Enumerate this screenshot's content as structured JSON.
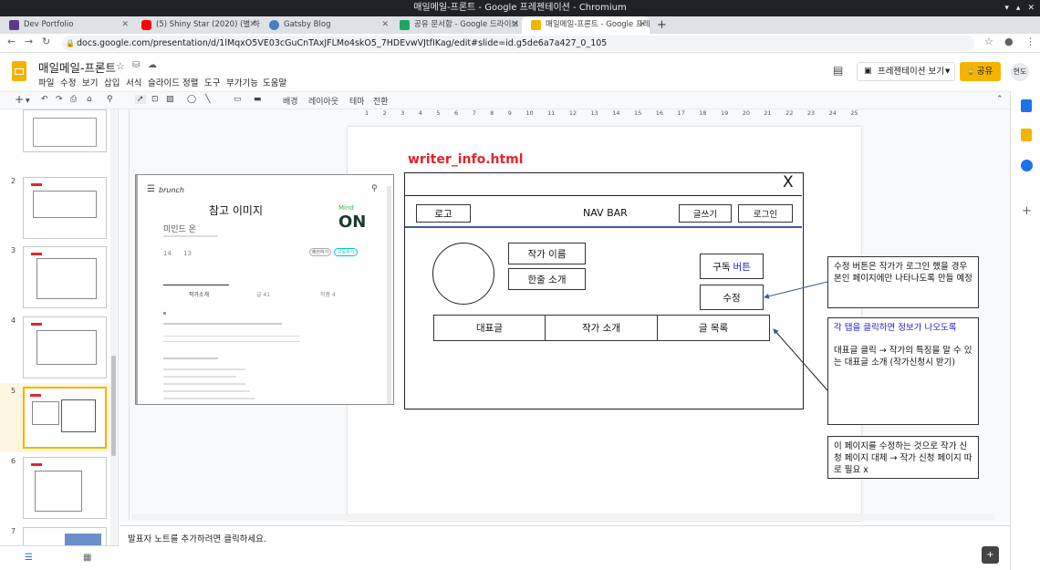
{
  "window": {
    "title": "매일메일-프론트 - Google 프레젠테이션 - Chromium"
  },
  "tabs": [
    {
      "label": "Dev Portfolio",
      "color": "#5b3a8e"
    },
    {
      "label": "(5) Shiny Star (2020) (별 하",
      "color": "#ff0000"
    },
    {
      "label": "Gatsby Blog",
      "color": "#4a7fc1"
    },
    {
      "label": "공유 문서함 - Google 드라이브",
      "color": "#1fa463"
    },
    {
      "label": "매일메일-프론트 - Google 프레젠",
      "color": "#f4b400"
    }
  ],
  "address": {
    "url": "docs.google.com/presentation/d/1lMqxO5VE03cGuCnTAxJFLMo4skO5_7HDEvwVJtfIKag/edit#slide=id.g5de6a7a427_0_105"
  },
  "doc": {
    "title": "매일메일-프론트",
    "menu": [
      "파일",
      "수정",
      "보기",
      "삽입",
      "서식",
      "슬라이드",
      "정렬",
      "도구",
      "부가기능",
      "도움말"
    ],
    "present_label": "프레젠테이션 보기",
    "share_label": "공유",
    "avatar": "현도"
  },
  "toolbar": {
    "background": "배경",
    "layout": "레이아웃",
    "theme": "테마",
    "transition": "전환"
  },
  "ruler": {
    "ticks": [
      "1",
      "2",
      "3",
      "4",
      "5",
      "6",
      "7",
      "8",
      "9",
      "10",
      "11",
      "12",
      "13",
      "14",
      "15",
      "16",
      "17",
      "18",
      "19",
      "20",
      "21",
      "22",
      "23",
      "24",
      "25"
    ]
  },
  "thumbnails": [
    {
      "num": ""
    },
    {
      "num": "2"
    },
    {
      "num": "3"
    },
    {
      "num": "4"
    },
    {
      "num": "5"
    },
    {
      "num": "6"
    },
    {
      "num": "7"
    }
  ],
  "slide": {
    "heading": "writer_info.html",
    "reference": {
      "caption": "참고 이미지",
      "brand": "brunch",
      "logo_text": "ON",
      "author": "미인드 온",
      "tab1": "작가소개",
      "tab2": "글 41",
      "tab3": "작품 4",
      "btn1": "제안하기",
      "btn2": "구독하기",
      "stat1": "14",
      "stat2": "13"
    },
    "wire": {
      "close": "X",
      "logo": "로고",
      "navbar": "NAV BAR",
      "write": "글쓰기",
      "login": "로그인",
      "author_name": "작가 이름",
      "oneline": "한줄 소개",
      "subscribe": "구독",
      "subscribe_suffix": "버튼",
      "edit": "수정",
      "tab_featured": "대표글",
      "tab_intro": "작가 소개",
      "tab_list": "글 목록"
    },
    "notes": {
      "note1": "수정 버튼은 작가가 로그인 했을 경우 본인 페이지에만 나타나도록 만들 예정",
      "note2_title": "각 탭을 클릭하면 정보가 나오도록",
      "note2_body": "대표글 클릭 → 작가의 특징을 알 수 있는 대표글 소개 (작가신청시 받기)",
      "note3": "이 페이지를 수정하는 것으로 작가 신청 페이지 대체 →  작가 신청 페이지 따로 필요 x"
    }
  },
  "speaker_notes": {
    "placeholder": "발표자 노트를 추가하려면 클릭하세요."
  },
  "colors": {
    "accent": "#f4b400",
    "heading": "#e3242b",
    "blue_text": "#2323c8"
  }
}
